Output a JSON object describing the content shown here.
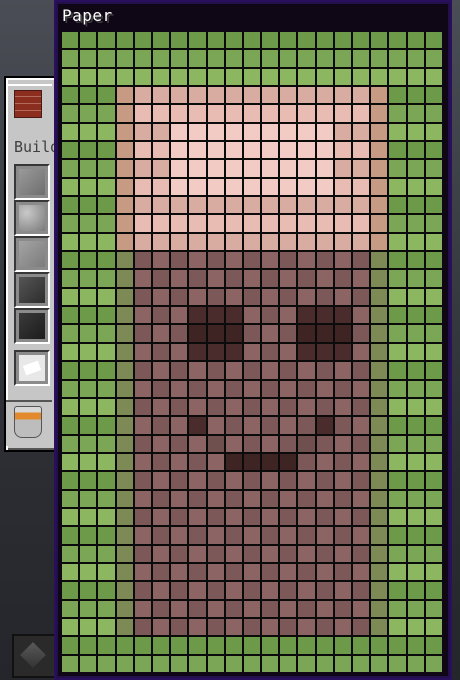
{
  "tooltip": {
    "title": "Paper"
  },
  "creative_tab": {
    "label": "Building Blocks"
  },
  "slots": [
    {
      "icon": "stone-block-icon",
      "tex": "stone"
    },
    {
      "icon": "gravel-block-icon",
      "tex": "gravel"
    },
    {
      "icon": "andesite-block-icon",
      "tex": "andesite"
    },
    {
      "icon": "deepslate-block-icon",
      "tex": "deepslate"
    },
    {
      "icon": "blackstone-block-icon",
      "tex": "blackstone"
    },
    {
      "icon": "paper-item-icon",
      "tex": "paperitem"
    }
  ],
  "colors": {
    "green_a": "#6d9a49",
    "green_b": "#7aa655",
    "green_c": "#8cb65f",
    "pink_a": "#d9aca2",
    "pink_b": "#e8bcb3",
    "pink_c": "#f2cbc4",
    "pink_edge": "#c79a83",
    "brown_a": "#8c6464",
    "brown_b": "#7d5858",
    "brown_c": "#70504e",
    "dark": "#4a2c2c",
    "darker": "#3f2424",
    "olive": "#7d8a55"
  },
  "grid": {
    "cols": 21,
    "rows": 35
  }
}
